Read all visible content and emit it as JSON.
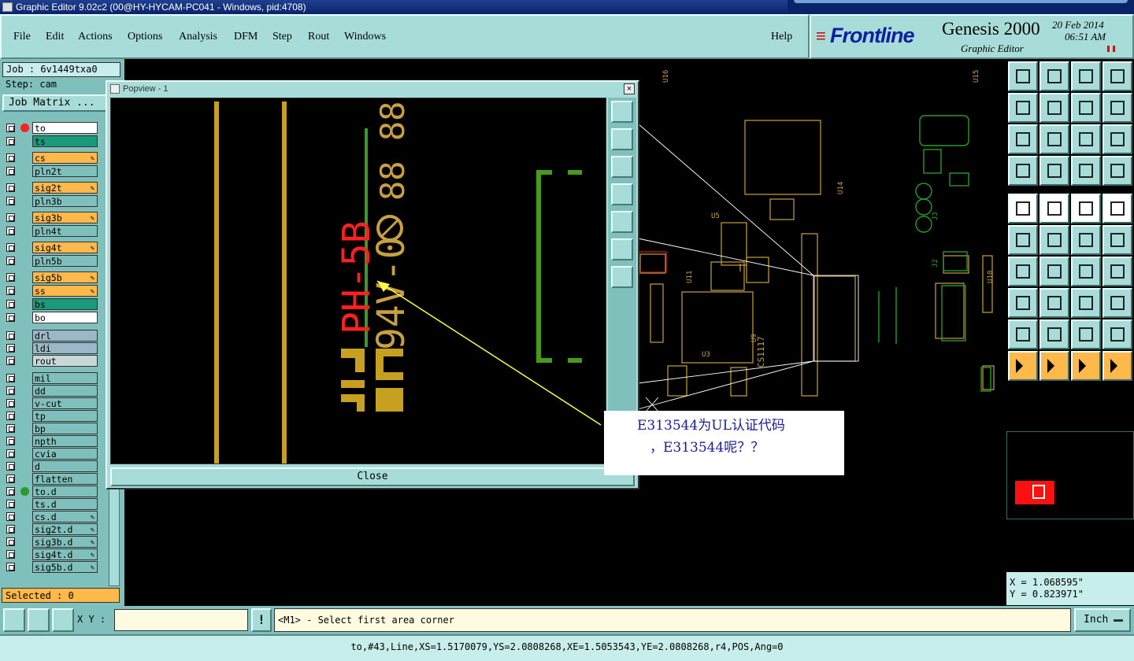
{
  "window": {
    "title": "Graphic Editor 9.02c2 (00@HY-HYCAM-PC041 - Windows, pid:4708)"
  },
  "menu": [
    "File",
    "Edit",
    "Actions",
    "Options",
    "Analysis",
    "DFM",
    "Step",
    "Rout",
    "Windows"
  ],
  "help_label": "Help",
  "brand": {
    "logo": "Frontline",
    "product": "Genesis 2000",
    "subtitle": "Graphic Editor",
    "date": "20 Feb 2014",
    "time": "06:51 AM"
  },
  "job": {
    "job_label": "Job : 6v1449txa0",
    "step_label": "Step: cam",
    "matrix_label": "Job Matrix ..."
  },
  "layers": [
    {
      "name": "to",
      "color": "#ffffff",
      "dot": "#ff2020"
    },
    {
      "name": "ts",
      "color": "#1a9a7a"
    },
    {
      "name": "cs",
      "color": "#ffb84a",
      "tag": "✎"
    },
    {
      "name": "pln2t",
      "color": "#7fbfbc"
    },
    {
      "name": "sig2t",
      "color": "#ffb84a",
      "tag": "✎"
    },
    {
      "name": "pln3b",
      "color": "#7fbfbc"
    },
    {
      "name": "sig3b",
      "color": "#ffb84a",
      "tag": "✎"
    },
    {
      "name": "pln4t",
      "color": "#7fbfbc"
    },
    {
      "name": "sig4t",
      "color": "#ffb84a",
      "tag": "✎"
    },
    {
      "name": "pln5b",
      "color": "#7fbfbc"
    },
    {
      "name": "sig5b",
      "color": "#ffb84a",
      "tag": "✎"
    },
    {
      "name": "ss",
      "color": "#ffb84a",
      "tag": "✎"
    },
    {
      "name": "bs",
      "color": "#1a9a7a"
    },
    {
      "name": "bo",
      "color": "#ffffff"
    },
    {
      "name": "drl",
      "color": "#9ab8c8"
    },
    {
      "name": "ldi",
      "color": "#9ab8c8"
    },
    {
      "name": "rout",
      "color": "#c8d8d8"
    },
    {
      "name": "mil",
      "color": "#7fbfbc"
    },
    {
      "name": "dd",
      "color": "#7fbfbc"
    },
    {
      "name": "v-cut",
      "color": "#7fbfbc"
    },
    {
      "name": "tp",
      "color": "#7fbfbc"
    },
    {
      "name": "bp",
      "color": "#7fbfbc"
    },
    {
      "name": "npth",
      "color": "#7fbfbc"
    },
    {
      "name": "cvia",
      "color": "#7fbfbc"
    },
    {
      "name": "d",
      "color": "#7fbfbc"
    },
    {
      "name": "flatten",
      "color": "#7fbfbc"
    },
    {
      "name": "to.d",
      "color": "#7fbfbc",
      "dot": "#2a9a2a"
    },
    {
      "name": "ts.d",
      "color": "#7fbfbc"
    },
    {
      "name": "cs.d",
      "color": "#7fbfbc",
      "tag": "✎"
    },
    {
      "name": "sig2t.d",
      "color": "#7fbfbc",
      "tag": "✎"
    },
    {
      "name": "sig3b.d",
      "color": "#7fbfbc",
      "tag": "✎"
    },
    {
      "name": "sig4t.d",
      "color": "#7fbfbc",
      "tag": "✎"
    },
    {
      "name": "sig5b.d",
      "color": "#7fbfbc",
      "tag": "✎"
    }
  ],
  "selected": "Selected : 0",
  "popview": {
    "title": "Popview - 1",
    "close_label": "Close",
    "label_red": "PH-5B",
    "label_gold": "94V-0",
    "digits": "88 88"
  },
  "annotation": {
    "line1": "E313544为UL认证代码",
    "line2": "，E313544呢？？"
  },
  "bottom": {
    "xy_label": "X Y :",
    "xy_value": "",
    "prompt": "<M1> - Select first area corner",
    "unit": "Inch"
  },
  "coords": {
    "x": "X = 1.068595\"",
    "y": "Y = 0.823971\""
  },
  "status": "to,#43,Line,XS=1.5170079,YS=2.0808268,XE=1.5053543,YE=2.0808268,r4,POS,Ang=0",
  "pcb_labels": {
    "u16": "U16",
    "u15": "U15",
    "u14": "U14",
    "u11": "U11",
    "u10": "U10",
    "u9": "U9",
    "u5": "U5",
    "u3": "U3",
    "j3": "J3",
    "j2": "J2",
    "cs": "CS1117"
  }
}
